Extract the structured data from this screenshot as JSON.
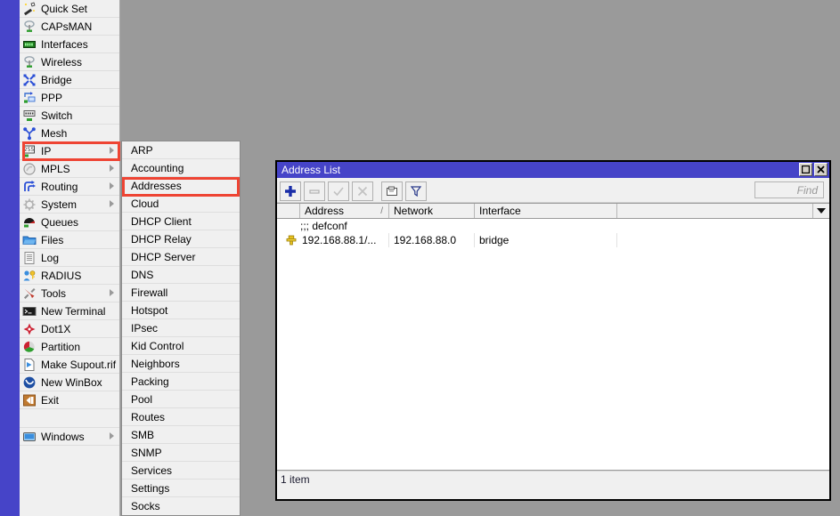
{
  "theme": {
    "accent": "#4644c8",
    "desktop_bg": "#9a9a9a",
    "menu_bg": "#f0f0f0",
    "highlight_red": "#ee4433",
    "titlebar_text": "#ffffff"
  },
  "main_menu": {
    "items": [
      {
        "label": "Quick Set",
        "icon": "magic-wand-icon",
        "has_submenu": false
      },
      {
        "label": "CAPsMAN",
        "icon": "capsman-icon",
        "has_submenu": false
      },
      {
        "label": "Interfaces",
        "icon": "interfaces-icon",
        "has_submenu": false
      },
      {
        "label": "Wireless",
        "icon": "wireless-icon",
        "has_submenu": false
      },
      {
        "label": "Bridge",
        "icon": "bridge-icon",
        "has_submenu": false
      },
      {
        "label": "PPP",
        "icon": "ppp-icon",
        "has_submenu": false
      },
      {
        "label": "Switch",
        "icon": "switch-icon",
        "has_submenu": false
      },
      {
        "label": "Mesh",
        "icon": "mesh-icon",
        "has_submenu": false
      },
      {
        "label": "IP",
        "icon": "ip-icon",
        "has_submenu": true
      },
      {
        "label": "MPLS",
        "icon": "mpls-icon",
        "has_submenu": true
      },
      {
        "label": "Routing",
        "icon": "routing-icon",
        "has_submenu": true
      },
      {
        "label": "System",
        "icon": "system-gear-icon",
        "has_submenu": true
      },
      {
        "label": "Queues",
        "icon": "queues-icon",
        "has_submenu": false
      },
      {
        "label": "Files",
        "icon": "folder-icon",
        "has_submenu": false
      },
      {
        "label": "Log",
        "icon": "log-icon",
        "has_submenu": false
      },
      {
        "label": "RADIUS",
        "icon": "radius-icon",
        "has_submenu": false
      },
      {
        "label": "Tools",
        "icon": "tools-icon",
        "has_submenu": true
      },
      {
        "label": "New Terminal",
        "icon": "terminal-icon",
        "has_submenu": false
      },
      {
        "label": "Dot1X",
        "icon": "dot1x-icon",
        "has_submenu": false
      },
      {
        "label": "Partition",
        "icon": "partition-icon",
        "has_submenu": false
      },
      {
        "label": "Make Supout.rif",
        "icon": "supout-icon",
        "has_submenu": false
      },
      {
        "label": "New WinBox",
        "icon": "winbox-icon",
        "has_submenu": false
      },
      {
        "label": "Exit",
        "icon": "exit-icon",
        "has_submenu": false
      }
    ],
    "footer_items": [
      {
        "label": "Windows",
        "icon": "windows-icon",
        "has_submenu": true
      }
    ],
    "selected": "IP"
  },
  "ip_submenu": {
    "parent": "IP",
    "selected": "Addresses",
    "items": [
      {
        "label": "ARP"
      },
      {
        "label": "Accounting"
      },
      {
        "label": "Addresses"
      },
      {
        "label": "Cloud"
      },
      {
        "label": "DHCP Client"
      },
      {
        "label": "DHCP Relay"
      },
      {
        "label": "DHCP Server"
      },
      {
        "label": "DNS"
      },
      {
        "label": "Firewall"
      },
      {
        "label": "Hotspot"
      },
      {
        "label": "IPsec"
      },
      {
        "label": "Kid Control"
      },
      {
        "label": "Neighbors"
      },
      {
        "label": "Packing"
      },
      {
        "label": "Pool"
      },
      {
        "label": "Routes"
      },
      {
        "label": "SMB"
      },
      {
        "label": "SNMP"
      },
      {
        "label": "Services"
      },
      {
        "label": "Settings"
      },
      {
        "label": "Socks"
      }
    ]
  },
  "address_window": {
    "title": "Address List",
    "titlebar_buttons": [
      {
        "name": "maximize-button",
        "icon": "maximize-icon"
      },
      {
        "name": "close-button",
        "icon": "close-icon"
      }
    ],
    "toolbar": [
      {
        "name": "add-button",
        "icon": "plus-icon",
        "enabled": true,
        "tooltip": "Add"
      },
      {
        "name": "remove-button",
        "icon": "minus-icon",
        "enabled": false,
        "tooltip": "Remove"
      },
      {
        "name": "enable-button",
        "icon": "check-icon",
        "enabled": false,
        "tooltip": "Enable"
      },
      {
        "name": "disable-button",
        "icon": "cross-icon",
        "enabled": false,
        "tooltip": "Disable"
      },
      {
        "name": "comment-button",
        "icon": "comment-icon",
        "enabled": true,
        "tooltip": "Comment"
      },
      {
        "name": "filter-button",
        "icon": "filter-icon",
        "enabled": true,
        "tooltip": "Filter"
      }
    ],
    "find": {
      "placeholder": "Find",
      "value": ""
    },
    "columns": [
      {
        "key": "flag",
        "label": ""
      },
      {
        "key": "address",
        "label": "Address",
        "sorted": true,
        "sort_mark": "/"
      },
      {
        "key": "network",
        "label": "Network"
      },
      {
        "key": "interface",
        "label": "Interface"
      },
      {
        "key": "rest",
        "label": ""
      }
    ],
    "column_dropdown_icon": "chevron-down-icon",
    "groups": [
      {
        "comment": ";;; defconf",
        "rows": [
          {
            "flag_icon": "address-pin-icon",
            "address": "192.168.88.1/...",
            "network": "192.168.88.0",
            "interface": "bridge",
            "rest": ""
          }
        ]
      }
    ],
    "status": "1 item"
  }
}
